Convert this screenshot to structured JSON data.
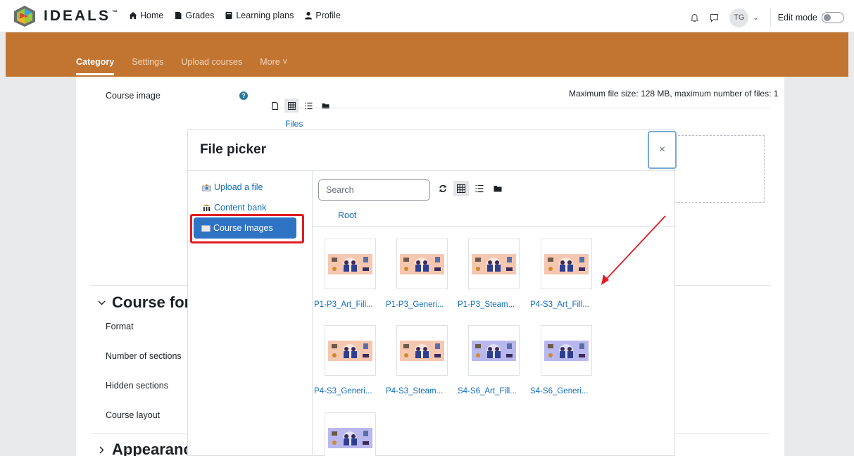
{
  "brand": {
    "name": "IDEALS",
    "tm": "™"
  },
  "nav": {
    "home": "Home",
    "grades": "Grades",
    "learning_plans": "Learning plans",
    "profile": "Profile",
    "avatar_initials": "TG",
    "edit_mode": "Edit mode"
  },
  "secondary_nav": {
    "tabs": [
      "Category",
      "Settings",
      "Upload courses",
      "More ˅"
    ],
    "active": "Category"
  },
  "form": {
    "course_image_label": "Course image",
    "help_icon": "?",
    "max_size_text": "Maximum file size: 128 MB, maximum number of files: 1",
    "files_link": "Files",
    "course_format_heading": "Course form",
    "format_label": "Format",
    "sections_label": "Number of sections",
    "hidden_sections_label": "Hidden sections",
    "course_layout_label": "Course layout",
    "appearance_heading": "Appearanc"
  },
  "file_picker": {
    "title": "File picker",
    "close": "×",
    "repositories": [
      {
        "label": "Upload a file",
        "icon": "upload-icon"
      },
      {
        "label": "Content bank",
        "icon": "content-bank-icon"
      },
      {
        "label": "Course Images",
        "icon": "folder-icon"
      }
    ],
    "active_repository": "Course Images",
    "search_placeholder": "Search",
    "breadcrumb": "Root",
    "files": [
      {
        "name": "P1-P3_Art_Fill...",
        "color": "#f5c7b0"
      },
      {
        "name": "P1-P3_Generi...",
        "color": "#f5c7b0"
      },
      {
        "name": "P1-P3_Steam...",
        "color": "#f5c7b0"
      },
      {
        "name": "P4-S3_Art_Fill...",
        "color": "#f5c7b0"
      },
      {
        "name": "P4-S3_Generi...",
        "color": "#f5c7b0"
      },
      {
        "name": "P4-S3_Steam...",
        "color": "#f5c7b0"
      },
      {
        "name": "S4-S6_Art_Fill...",
        "color": "#b9b8ee"
      },
      {
        "name": "S4-S6_Generi...",
        "color": "#b9b8ee"
      },
      {
        "name": "",
        "color": "#b9b8ee"
      }
    ]
  },
  "colors": {
    "brand_orange": "#c27431",
    "link_blue": "#0f6cbf",
    "highlight_red": "#e21b22"
  }
}
